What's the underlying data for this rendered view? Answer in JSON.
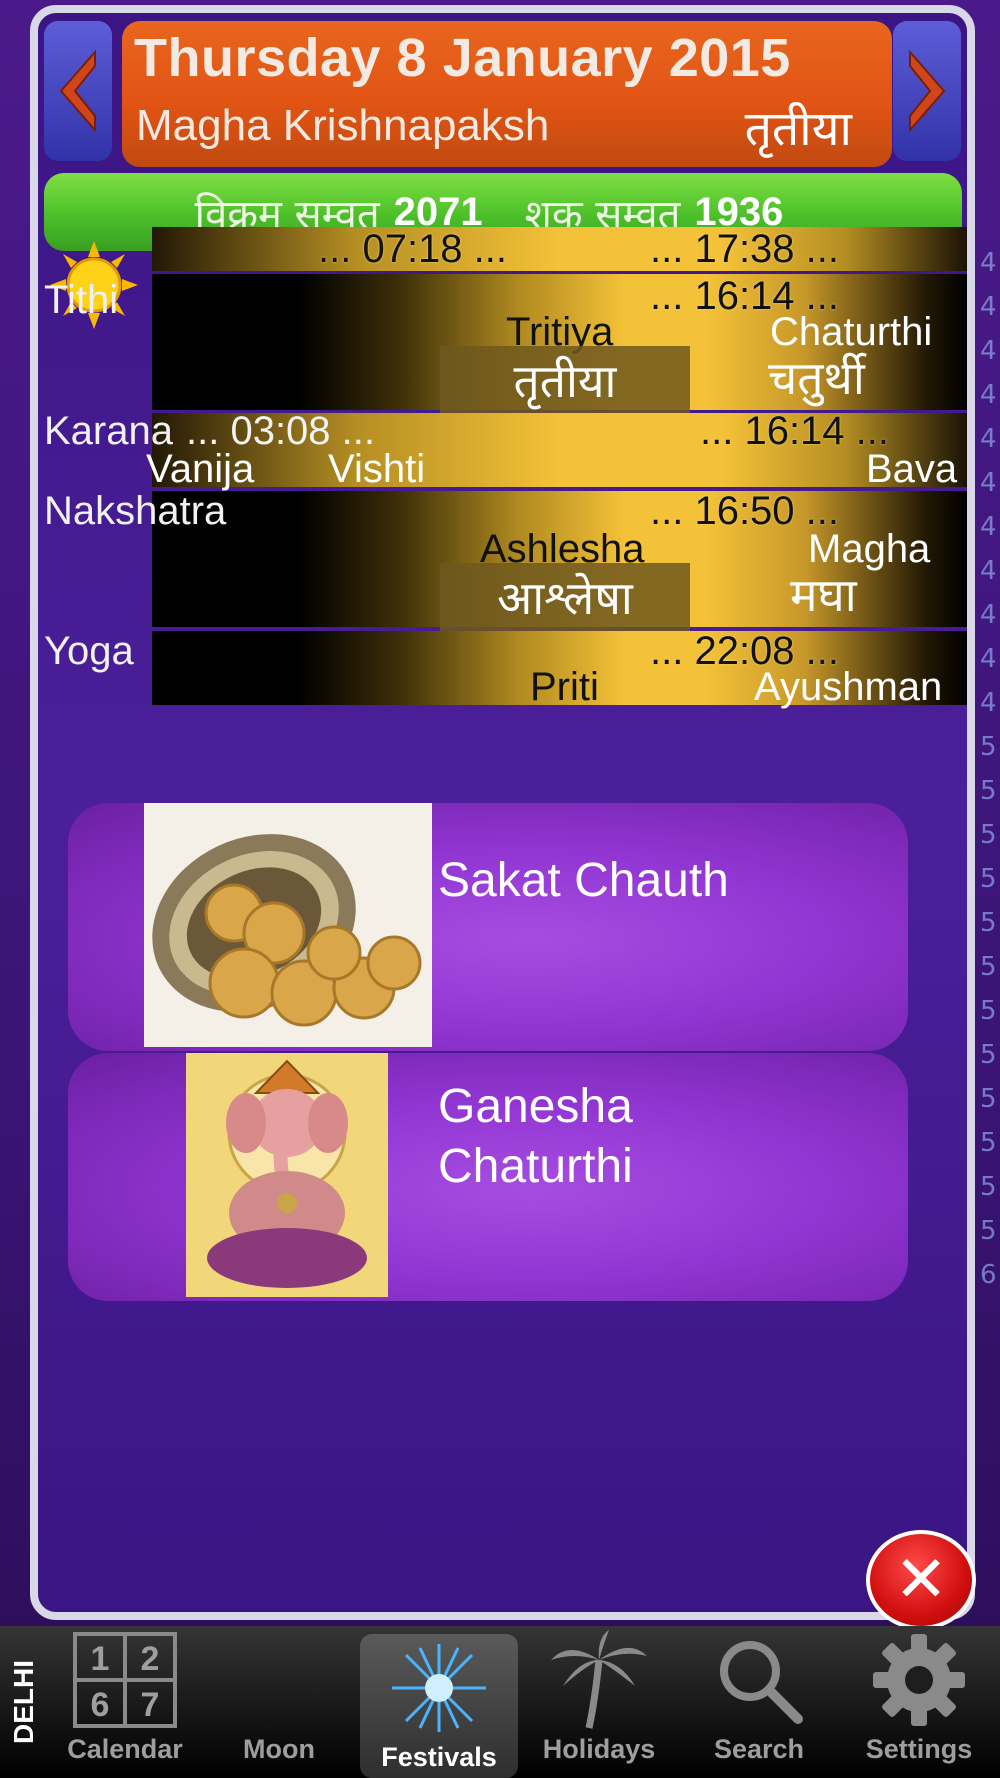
{
  "header": {
    "date": "Thursday 8 January 2015",
    "month": "Magha Krishnapaksh",
    "tithi_hindi": "तृतीया"
  },
  "samvat": {
    "vikram_label": "विक्रम सम्वत्",
    "vikram_year": "2071",
    "shak_label": "शक् सम्वत्",
    "shak_year": "1936"
  },
  "sun": {
    "sunrise": "... 07:18 ...",
    "sunset": "... 17:38 ..."
  },
  "tithi": {
    "label": "Tithi",
    "end_time": "... 16:14 ...",
    "current": "Tritiya",
    "current_hindi": "तृतीया",
    "next": "Chaturthi",
    "next_hindi": "चतुर्थी"
  },
  "karana": {
    "label": "Karana",
    "time1": "... 03:08 ...",
    "time2": "... 16:14 ...",
    "names": [
      "Vanija",
      "Vishti",
      "Bava"
    ]
  },
  "nakshatra": {
    "label": "Nakshatra",
    "end_time": "... 16:50 ...",
    "current": "Ashlesha",
    "current_hindi": "आश्लेषा",
    "next": "Magha",
    "next_hindi": "मघा"
  },
  "yoga": {
    "label": "Yoga",
    "end_time": "... 22:08 ...",
    "current": "Priti",
    "next": "Ayushman"
  },
  "festivals": [
    {
      "name": "Sakat Chauth"
    },
    {
      "name_line1": "Ganesha",
      "name_line2": "Chaturthi"
    }
  ],
  "edge_numbers": [
    "4",
    "4",
    "4",
    "4",
    "4",
    "4",
    "4",
    "4",
    "4",
    "4",
    "4",
    "5",
    "5",
    "5",
    "5",
    "5",
    "5",
    "5",
    "5",
    "5",
    "5",
    "5",
    "5",
    "6"
  ],
  "tabbar": {
    "city": "DELHI",
    "calendar_digits": [
      "1",
      "2",
      "6",
      "7"
    ],
    "tabs": [
      {
        "label": "Calendar",
        "icon": "calendar-icon"
      },
      {
        "label": "Moon",
        "icon": "moon-icon"
      },
      {
        "label": "Festivals",
        "icon": "festivals-icon",
        "active": true
      },
      {
        "label": "Holidays",
        "icon": "palm-tree-icon"
      },
      {
        "label": "Search",
        "icon": "search-icon"
      },
      {
        "label": "Settings",
        "icon": "gear-icon"
      }
    ]
  },
  "colors": {
    "accent_orange": "#e25414",
    "samvat_green": "#4cbf2a",
    "band_gold": "#f4c238",
    "card_purple": "#3a1583"
  }
}
